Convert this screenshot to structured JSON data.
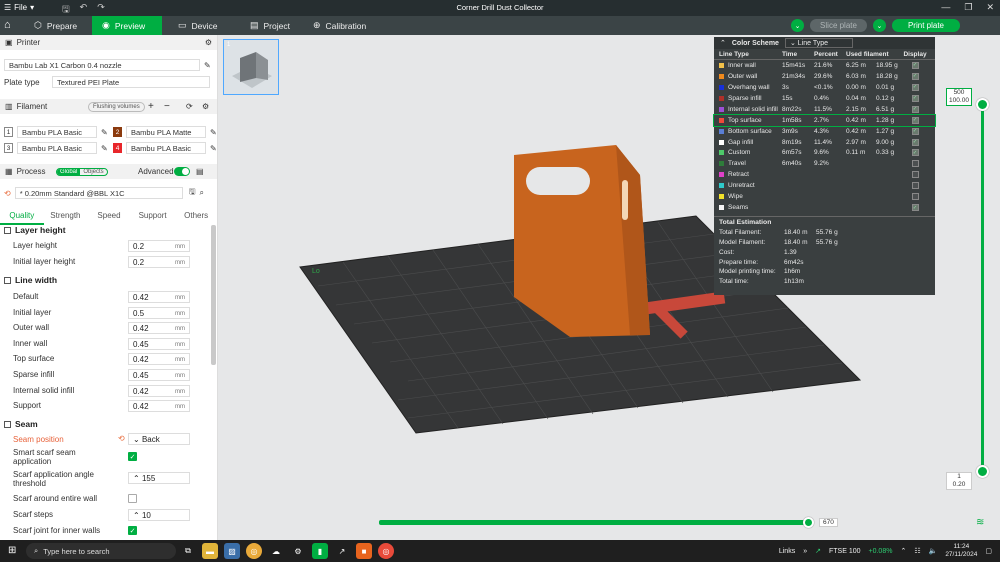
{
  "titlebar": {
    "file_label": "File",
    "title": "Corner Drill Dust Collector"
  },
  "tabs": [
    {
      "label": "Prepare",
      "icon": "cube-icon"
    },
    {
      "label": "Preview",
      "icon": "eye-icon"
    },
    {
      "label": "Device",
      "icon": "monitor-icon"
    },
    {
      "label": "Project",
      "icon": "project-icon"
    },
    {
      "label": "Calibration",
      "icon": "target-icon"
    }
  ],
  "actions": {
    "slice_label": "Slice plate",
    "print_label": "Print plate"
  },
  "printer": {
    "section_label": "Printer",
    "name": "Bambu Lab X1 Carbon 0.4 nozzle",
    "plate_type_label": "Plate type",
    "plate_type": "Textured PEI Plate"
  },
  "filament": {
    "section_label": "Filament",
    "flushing_label": "Flushing volumes",
    "items": [
      {
        "num": "1",
        "name": "Bambu PLA Basic",
        "color": "#ffffff"
      },
      {
        "num": "2",
        "name": "Bambu PLA Matte",
        "color": "#8b3a0e"
      },
      {
        "num": "3",
        "name": "Bambu PLA Basic",
        "color": "#ffffff"
      },
      {
        "num": "4",
        "name": "Bambu PLA Basic",
        "color": "#e8262b"
      }
    ]
  },
  "process": {
    "section_label": "Process",
    "global_label": "Global",
    "objects_label": "Objects",
    "advanced_label": "Advanced",
    "preset": "* 0.20mm Standard @BBL X1C",
    "tabs": [
      "Quality",
      "Strength",
      "Speed",
      "Support",
      "Others"
    ]
  },
  "quality": {
    "layer_height_group": "Layer height",
    "layer_height": {
      "label": "Layer height",
      "value": "0.2",
      "unit": "mm"
    },
    "initial_layer_height": {
      "label": "Initial layer height",
      "value": "0.2",
      "unit": "mm"
    },
    "line_width_group": "Line width",
    "line_widths": [
      {
        "label": "Default",
        "value": "0.42",
        "unit": "mm"
      },
      {
        "label": "Initial layer",
        "value": "0.5",
        "unit": "mm"
      },
      {
        "label": "Outer wall",
        "value": "0.42",
        "unit": "mm"
      },
      {
        "label": "Inner wall",
        "value": "0.45",
        "unit": "mm"
      },
      {
        "label": "Top surface",
        "value": "0.42",
        "unit": "mm"
      },
      {
        "label": "Sparse infill",
        "value": "0.45",
        "unit": "mm"
      },
      {
        "label": "Internal solid infill",
        "value": "0.42",
        "unit": "mm"
      },
      {
        "label": "Support",
        "value": "0.42",
        "unit": "mm"
      }
    ],
    "seam_group": "Seam",
    "seam_position": {
      "label": "Seam position",
      "value": "Back"
    },
    "smart_scarf": {
      "label": "Smart scarf seam application",
      "checked": true
    },
    "scarf_angle": {
      "label": "Scarf application angle threshold",
      "value": "155"
    },
    "scarf_entire": {
      "label": "Scarf around entire wall",
      "checked": false
    },
    "scarf_steps": {
      "label": "Scarf steps",
      "value": "10"
    },
    "scarf_inner": {
      "label": "Scarf joint for inner walls",
      "checked": true
    }
  },
  "legend": {
    "title": "Color Scheme",
    "mode": "Line Type",
    "headers": [
      "Line Type",
      "Time",
      "Percent",
      "Used filament",
      "Display"
    ],
    "rows": [
      {
        "name": "Inner wall",
        "color": "#f2c14a",
        "time": "15m41s",
        "percent": "21.6%",
        "length": "6.25 m",
        "weight": "18.95 g",
        "display": true
      },
      {
        "name": "Outer wall",
        "color": "#f08a1d",
        "time": "21m34s",
        "percent": "29.6%",
        "length": "6.03 m",
        "weight": "18.28 g",
        "display": true
      },
      {
        "name": "Overhang wall",
        "color": "#1630d9",
        "time": "3s",
        "percent": "<0.1%",
        "length": "0.00 m",
        "weight": "0.01 g",
        "display": true
      },
      {
        "name": "Sparse infill",
        "color": "#b03029",
        "time": "15s",
        "percent": "0.4%",
        "length": "0.04 m",
        "weight": "0.12 g",
        "display": true
      },
      {
        "name": "Internal solid infill",
        "color": "#9c4fd6",
        "time": "8m22s",
        "percent": "11.5%",
        "length": "2.15 m",
        "weight": "6.51 g",
        "display": true
      },
      {
        "name": "Top surface",
        "color": "#f04a3a",
        "time": "1m58s",
        "percent": "2.7%",
        "length": "0.42 m",
        "weight": "1.28 g",
        "display": true,
        "highlight": true
      },
      {
        "name": "Bottom surface",
        "color": "#5a7fd6",
        "time": "3m9s",
        "percent": "4.3%",
        "length": "0.42 m",
        "weight": "1.27 g",
        "display": true
      },
      {
        "name": "Gap infill",
        "color": "#ffffff",
        "time": "8m19s",
        "percent": "11.4%",
        "length": "2.97 m",
        "weight": "9.00 g",
        "display": true
      },
      {
        "name": "Custom",
        "color": "#4ec96a",
        "time": "6m57s",
        "percent": "9.6%",
        "length": "0.11 m",
        "weight": "0.33 g",
        "display": true
      },
      {
        "name": "Travel",
        "color": "#2e7d3a",
        "time": "6m40s",
        "percent": "9.2%",
        "length": "",
        "weight": "",
        "display": false
      },
      {
        "name": "Retract",
        "color": "#e040c8",
        "time": "",
        "percent": "",
        "length": "",
        "weight": "",
        "display": false
      },
      {
        "name": "Unretract",
        "color": "#2ec9c9",
        "time": "",
        "percent": "",
        "length": "",
        "weight": "",
        "display": false
      },
      {
        "name": "Wipe",
        "color": "#f2e12a",
        "time": "",
        "percent": "",
        "length": "",
        "weight": "",
        "display": false
      },
      {
        "name": "Seams",
        "color": "#f5f5f5",
        "time": "",
        "percent": "",
        "length": "",
        "weight": "",
        "display": true
      }
    ],
    "estimation_title": "Total Estimation",
    "estimation": [
      {
        "label": "Total Filament:",
        "v1": "18.40 m",
        "v2": "55.76 g"
      },
      {
        "label": "Model Filament:",
        "v1": "18.40 m",
        "v2": "55.76 g"
      },
      {
        "label": "Cost:",
        "v1": "1.39",
        "v2": ""
      },
      {
        "label": "Prepare time:",
        "v1": "6m42s",
        "v2": ""
      },
      {
        "label": "Model printing time:",
        "v1": "1h6m",
        "v2": ""
      },
      {
        "label": "Total time:",
        "v1": "1h13m",
        "v2": ""
      }
    ]
  },
  "viewport": {
    "thumb_num": "1",
    "layer_top": "500",
    "height_top": "100.00",
    "layer_bottom": "1",
    "height_bottom": "0.20",
    "move_label": "670"
  },
  "taskbar": {
    "search_placeholder": "Type here to search",
    "links_label": "Links",
    "ftse_label": "FTSE 100",
    "ftse_change": "+0.08%",
    "time": "11:24",
    "date": "27/11/2024"
  },
  "colors": {
    "accent": "#00ae42",
    "model": "#c8641e",
    "bed": "#3a3a3a"
  }
}
